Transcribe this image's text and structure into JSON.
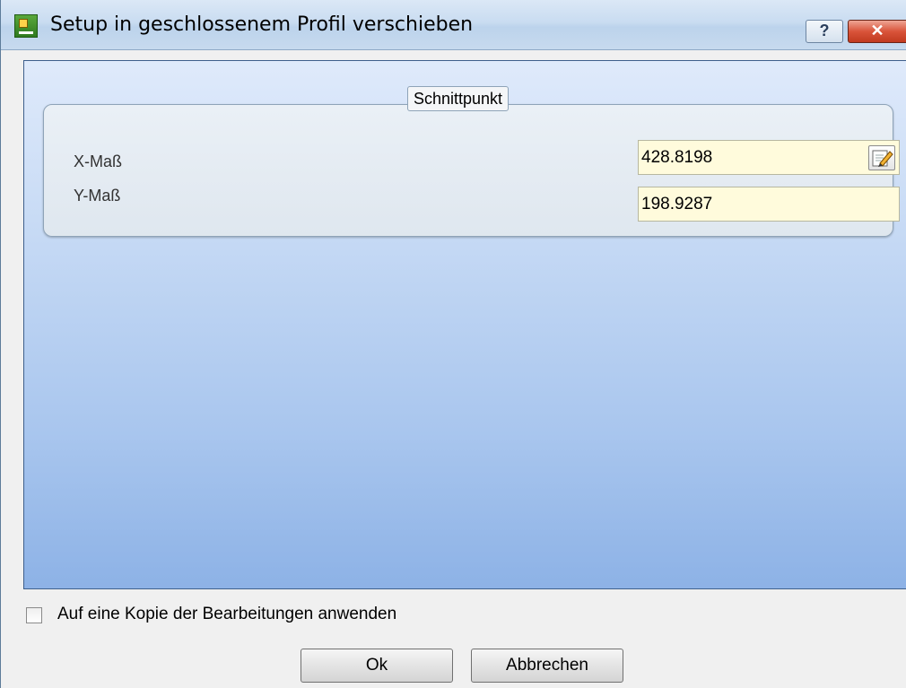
{
  "window": {
    "title": "Setup in geschlossenem Profil verschieben",
    "help_label": "?",
    "close_label": "✕"
  },
  "group": {
    "title": "Schnittpunkt",
    "fields": [
      {
        "label": "X-Maß",
        "value": "428.8198"
      },
      {
        "label": "Y-Maß",
        "value": "198.9287"
      }
    ]
  },
  "option": {
    "label": "Auf eine Kopie der Bearbeitungen anwenden",
    "checked": false
  },
  "buttons": {
    "ok": "Ok",
    "cancel": "Abbrechen"
  }
}
